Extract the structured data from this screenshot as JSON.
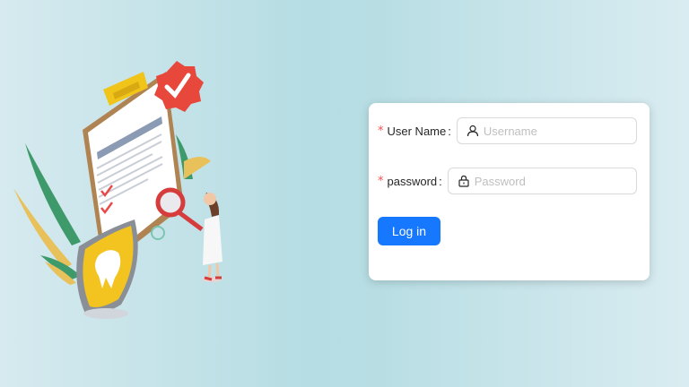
{
  "login_form": {
    "username_label": "User Name",
    "username_placeholder": "Username",
    "username_value": "",
    "password_label": "password",
    "password_placeholder": "Password",
    "password_value": "",
    "required_marker": "*",
    "colon": ":",
    "submit_label": "Log in"
  },
  "colors": {
    "primary": "#1677ff",
    "required": "#ff4d4f",
    "background": "#b5dde3"
  },
  "icons": {
    "username_field": "user-icon",
    "password_field": "lock-icon"
  }
}
